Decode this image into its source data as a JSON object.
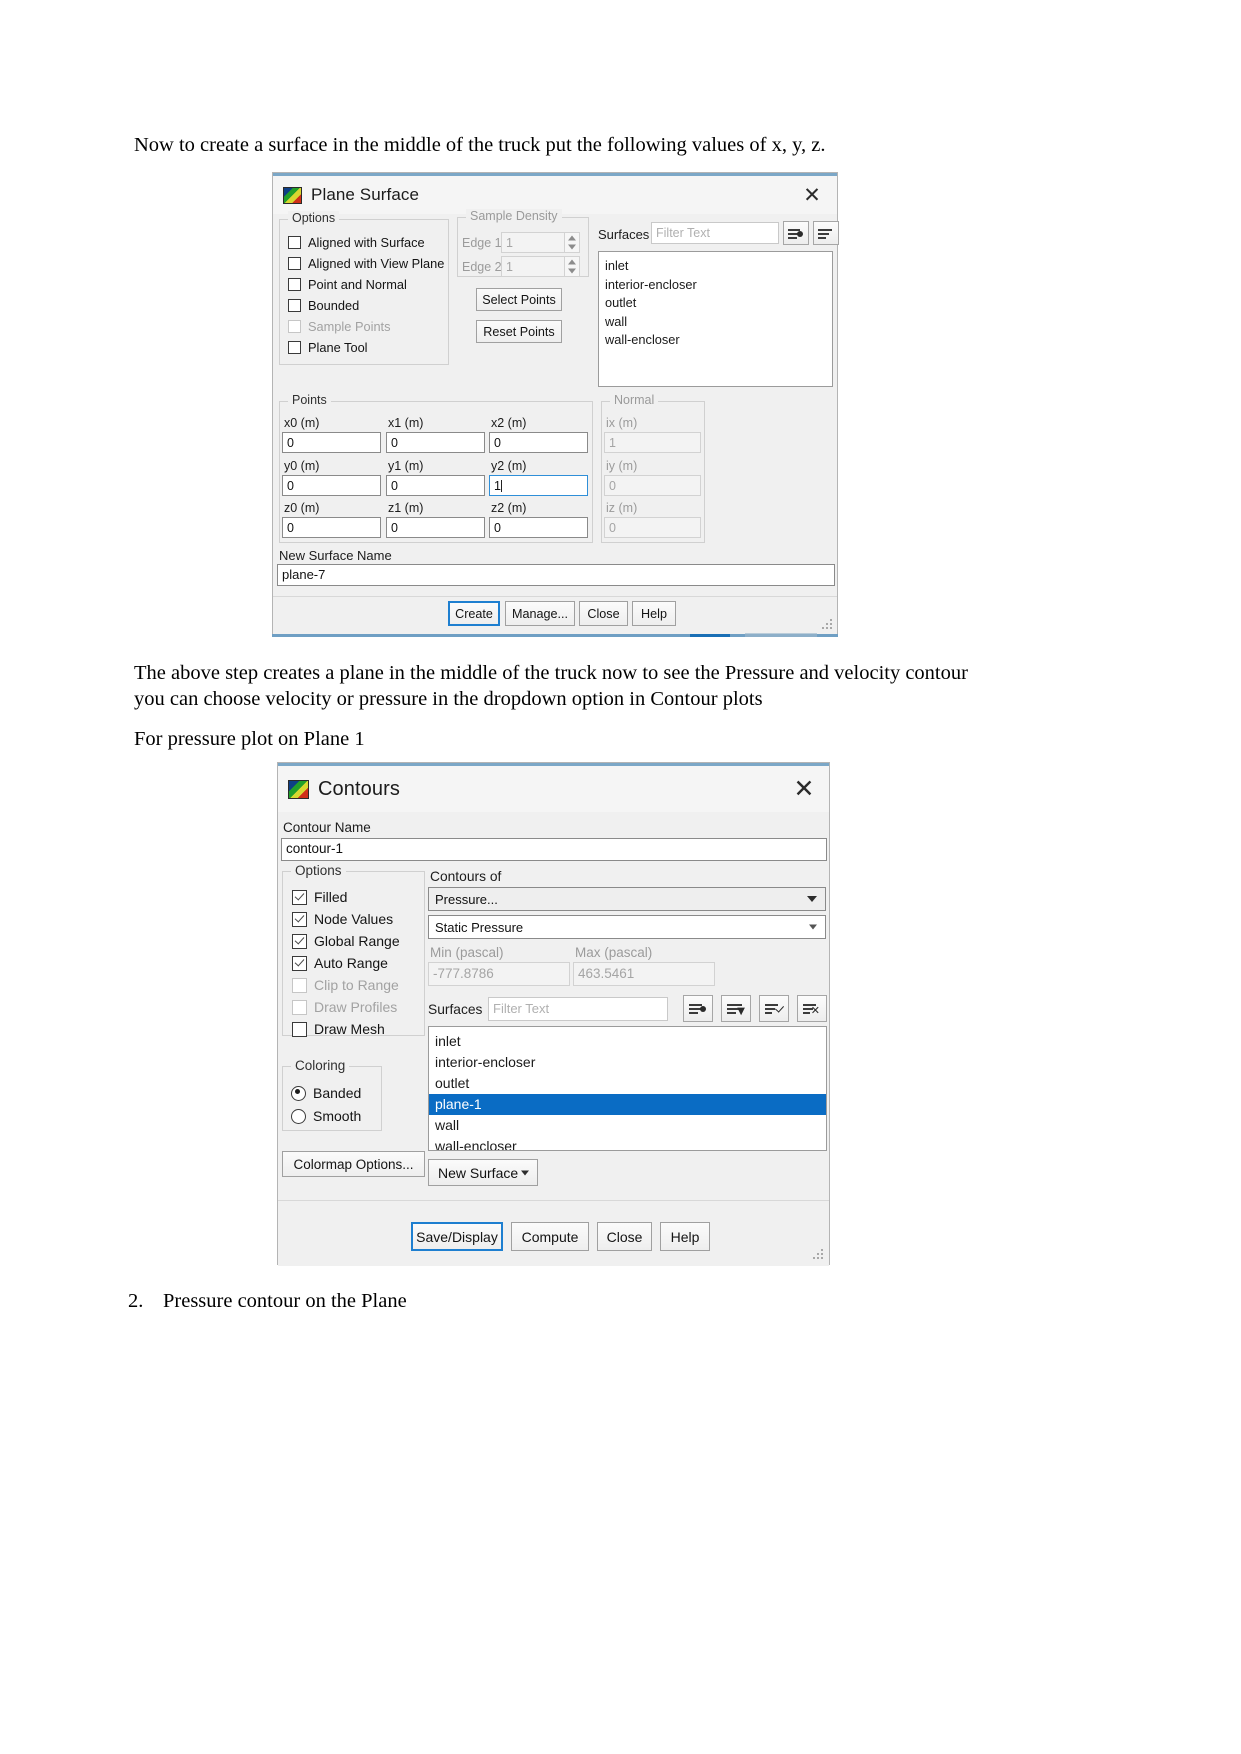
{
  "document": {
    "paragraph1": "Now to create a surface in the middle of the truck put the following values of x, y, z.",
    "paragraph2_line1": "The above step creates a plane in the middle of the truck now to see the Pressure and velocity contour",
    "paragraph2_line2": "you can choose velocity or pressure in the dropdown option in Contour plots",
    "paragraph3": "For pressure plot on Plane 1",
    "list_number": "2.",
    "list_item": "Pressure contour on the Plane"
  },
  "plane_surface_dialog": {
    "title": "Plane Surface",
    "close_label": "✕",
    "options": {
      "group_label": "Options",
      "items": [
        {
          "label": "Aligned with Surface",
          "checked": false,
          "enabled": true
        },
        {
          "label": "Aligned with View Plane",
          "checked": false,
          "enabled": true
        },
        {
          "label": "Point and Normal",
          "checked": false,
          "enabled": true
        },
        {
          "label": "Bounded",
          "checked": false,
          "enabled": true
        },
        {
          "label": "Sample Points",
          "checked": false,
          "enabled": false
        },
        {
          "label": "Plane Tool",
          "checked": false,
          "enabled": true
        }
      ]
    },
    "sample_density": {
      "group_label": "Sample Density",
      "edge1_label": "Edge 1",
      "edge1_value": "1",
      "edge2_label": "Edge 2",
      "edge2_value": "1",
      "select_points_label": "Select Points",
      "reset_points_label": "Reset Points"
    },
    "surfaces": {
      "label": "Surfaces",
      "filter_placeholder": "Filter Text",
      "items": [
        "inlet",
        "interior-encloser",
        "outlet",
        "wall",
        "wall-encloser"
      ]
    },
    "points": {
      "group_label": "Points",
      "rows": [
        {
          "labels": [
            "x0 (m)",
            "x1 (m)",
            "x2 (m)"
          ],
          "values": [
            "0",
            "0",
            "0"
          ],
          "focused": -1
        },
        {
          "labels": [
            "y0 (m)",
            "y1 (m)",
            "y2 (m)"
          ],
          "values": [
            "0",
            "0",
            "1"
          ],
          "focused": 2
        },
        {
          "labels": [
            "z0 (m)",
            "z1 (m)",
            "z2 (m)"
          ],
          "values": [
            "0",
            "0",
            "0"
          ],
          "focused": -1
        }
      ]
    },
    "normal": {
      "group_label": "Normal",
      "labels": [
        "ix (m)",
        "iy (m)",
        "iz (m)"
      ],
      "values": [
        "1",
        "0",
        "0"
      ]
    },
    "new_surface_name": {
      "label": "New Surface Name",
      "value": "plane-7"
    },
    "buttons": {
      "create": "Create",
      "manage": "Manage...",
      "close": "Close",
      "help": "Help"
    }
  },
  "contours_dialog": {
    "title": "Contours",
    "close_label": "✕",
    "contour_name": {
      "label": "Contour Name",
      "value": "contour-1"
    },
    "options": {
      "group_label": "Options",
      "items": [
        {
          "label": "Filled",
          "checked": true,
          "enabled": true
        },
        {
          "label": "Node Values",
          "checked": true,
          "enabled": true
        },
        {
          "label": "Global Range",
          "checked": true,
          "enabled": true
        },
        {
          "label": "Auto Range",
          "checked": true,
          "enabled": true
        },
        {
          "label": "Clip to Range",
          "checked": false,
          "enabled": false
        },
        {
          "label": "Draw Profiles",
          "checked": false,
          "enabled": false
        },
        {
          "label": "Draw Mesh",
          "checked": false,
          "enabled": true
        }
      ]
    },
    "coloring": {
      "group_label": "Coloring",
      "options": [
        {
          "label": "Banded",
          "selected": true
        },
        {
          "label": "Smooth",
          "selected": false
        }
      ]
    },
    "colormap_options_label": "Colormap Options...",
    "contours_of": {
      "label": "Contours of",
      "category_value": "Pressure...",
      "field_value": "Static Pressure",
      "min_label": "Min (pascal)",
      "max_label": "Max (pascal)",
      "min_value": "-777.8786",
      "max_value": "463.5461"
    },
    "surfaces": {
      "label": "Surfaces",
      "filter_placeholder": "Filter Text",
      "items": [
        "inlet",
        "interior-encloser",
        "outlet",
        "plane-1",
        "wall",
        "wall-encloser"
      ],
      "selected": "plane-1"
    },
    "new_surface_label": "New Surface",
    "buttons": {
      "save_display": "Save/Display",
      "compute": "Compute",
      "close": "Close",
      "help": "Help"
    }
  }
}
